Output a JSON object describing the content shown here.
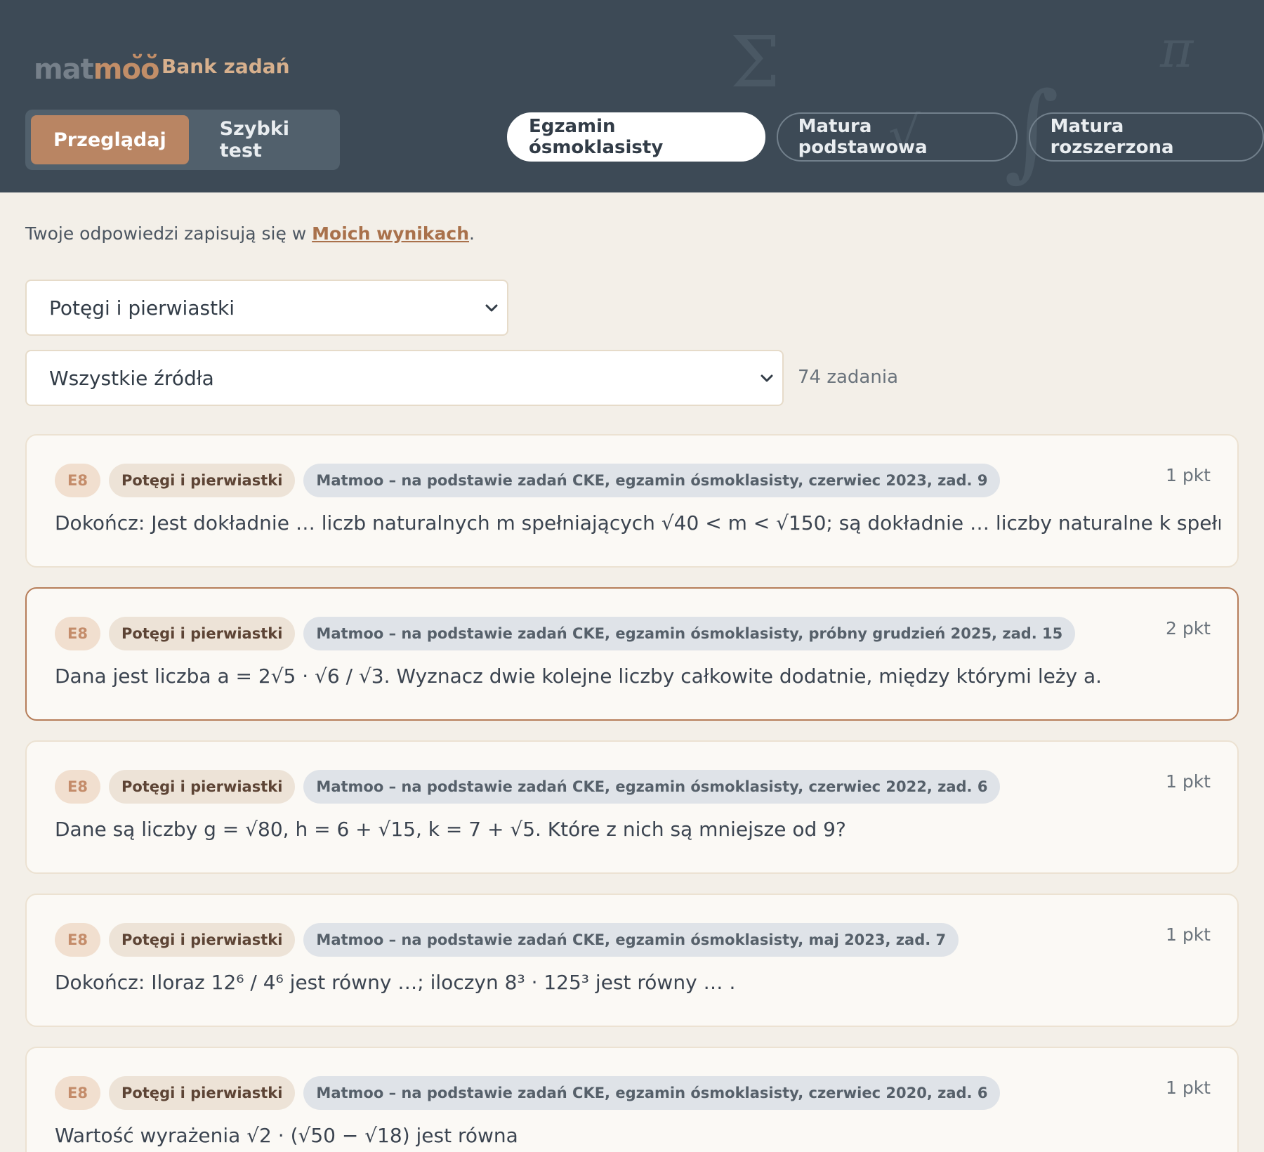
{
  "header": {
    "logo_text_1": "mat",
    "logo_text_2": "moo",
    "logo_horns": "ᴗ ᴗ",
    "app_title": "Bank zadań",
    "modes": [
      {
        "label": "Przeglądaj",
        "active": true
      },
      {
        "label": "Szybki test",
        "active": false
      }
    ],
    "exam_tabs": [
      {
        "label": "Egzamin ósmoklasisty",
        "active": true
      },
      {
        "label": "Matura podstawowa",
        "active": false
      },
      {
        "label": "Matura rozszerzona",
        "active": false
      }
    ],
    "decorations": [
      "Σ",
      "π",
      "∫",
      "√"
    ]
  },
  "info": {
    "prefix": "Twoje odpowiedzi zapisują się w ",
    "link": "Moich wynikach",
    "suffix": "."
  },
  "filters": {
    "topic_selected": "Potęgi i pierwiastki",
    "source_selected": "Wszystkie źródła",
    "count": "74 zadania"
  },
  "tasks": [
    {
      "level": "E8",
      "topic": "Potęgi i pierwiastki",
      "source": "Matmoo – na podstawie zadań CKE, egzamin ósmoklasisty, czerwiec 2023, zad. 9",
      "points": "1 pkt",
      "text": "Dokończ: Jest dokładnie … liczb naturalnych m spełniających √40 < m < √150; są dokładnie … liczby naturalne k spełniając"
    },
    {
      "level": "E8",
      "topic": "Potęgi i pierwiastki",
      "source": "Matmoo – na podstawie zadań CKE, egzamin ósmoklasisty, próbny grudzień 2025, zad. 15",
      "points": "2 pkt",
      "text": "Dana jest liczba a = 2√5 · √6 / √3. Wyznacz dwie kolejne liczby całkowite dodatnie, między którymi leży a."
    },
    {
      "level": "E8",
      "topic": "Potęgi i pierwiastki",
      "source": "Matmoo – na podstawie zadań CKE, egzamin ósmoklasisty, czerwiec 2022, zad. 6",
      "points": "1 pkt",
      "text": "Dane są liczby g = √80, h = 6 + √15, k = 7 + √5. Które z nich są mniejsze od 9?"
    },
    {
      "level": "E8",
      "topic": "Potęgi i pierwiastki",
      "source": "Matmoo – na podstawie zadań CKE, egzamin ósmoklasisty, maj 2023, zad. 7",
      "points": "1 pkt",
      "text": "Dokończ: Iloraz 12⁶ / 4⁶ jest równy …; iloczyn 8³ · 125³ jest równy … ."
    },
    {
      "level": "E8",
      "topic": "Potęgi i pierwiastki",
      "source": "Matmoo – na podstawie zadań CKE, egzamin ósmoklasisty, czerwiec 2020, zad. 6",
      "points": "1 pkt",
      "text": "Wartość wyrażenia √2 · (√50 − √18) jest równa"
    }
  ]
}
